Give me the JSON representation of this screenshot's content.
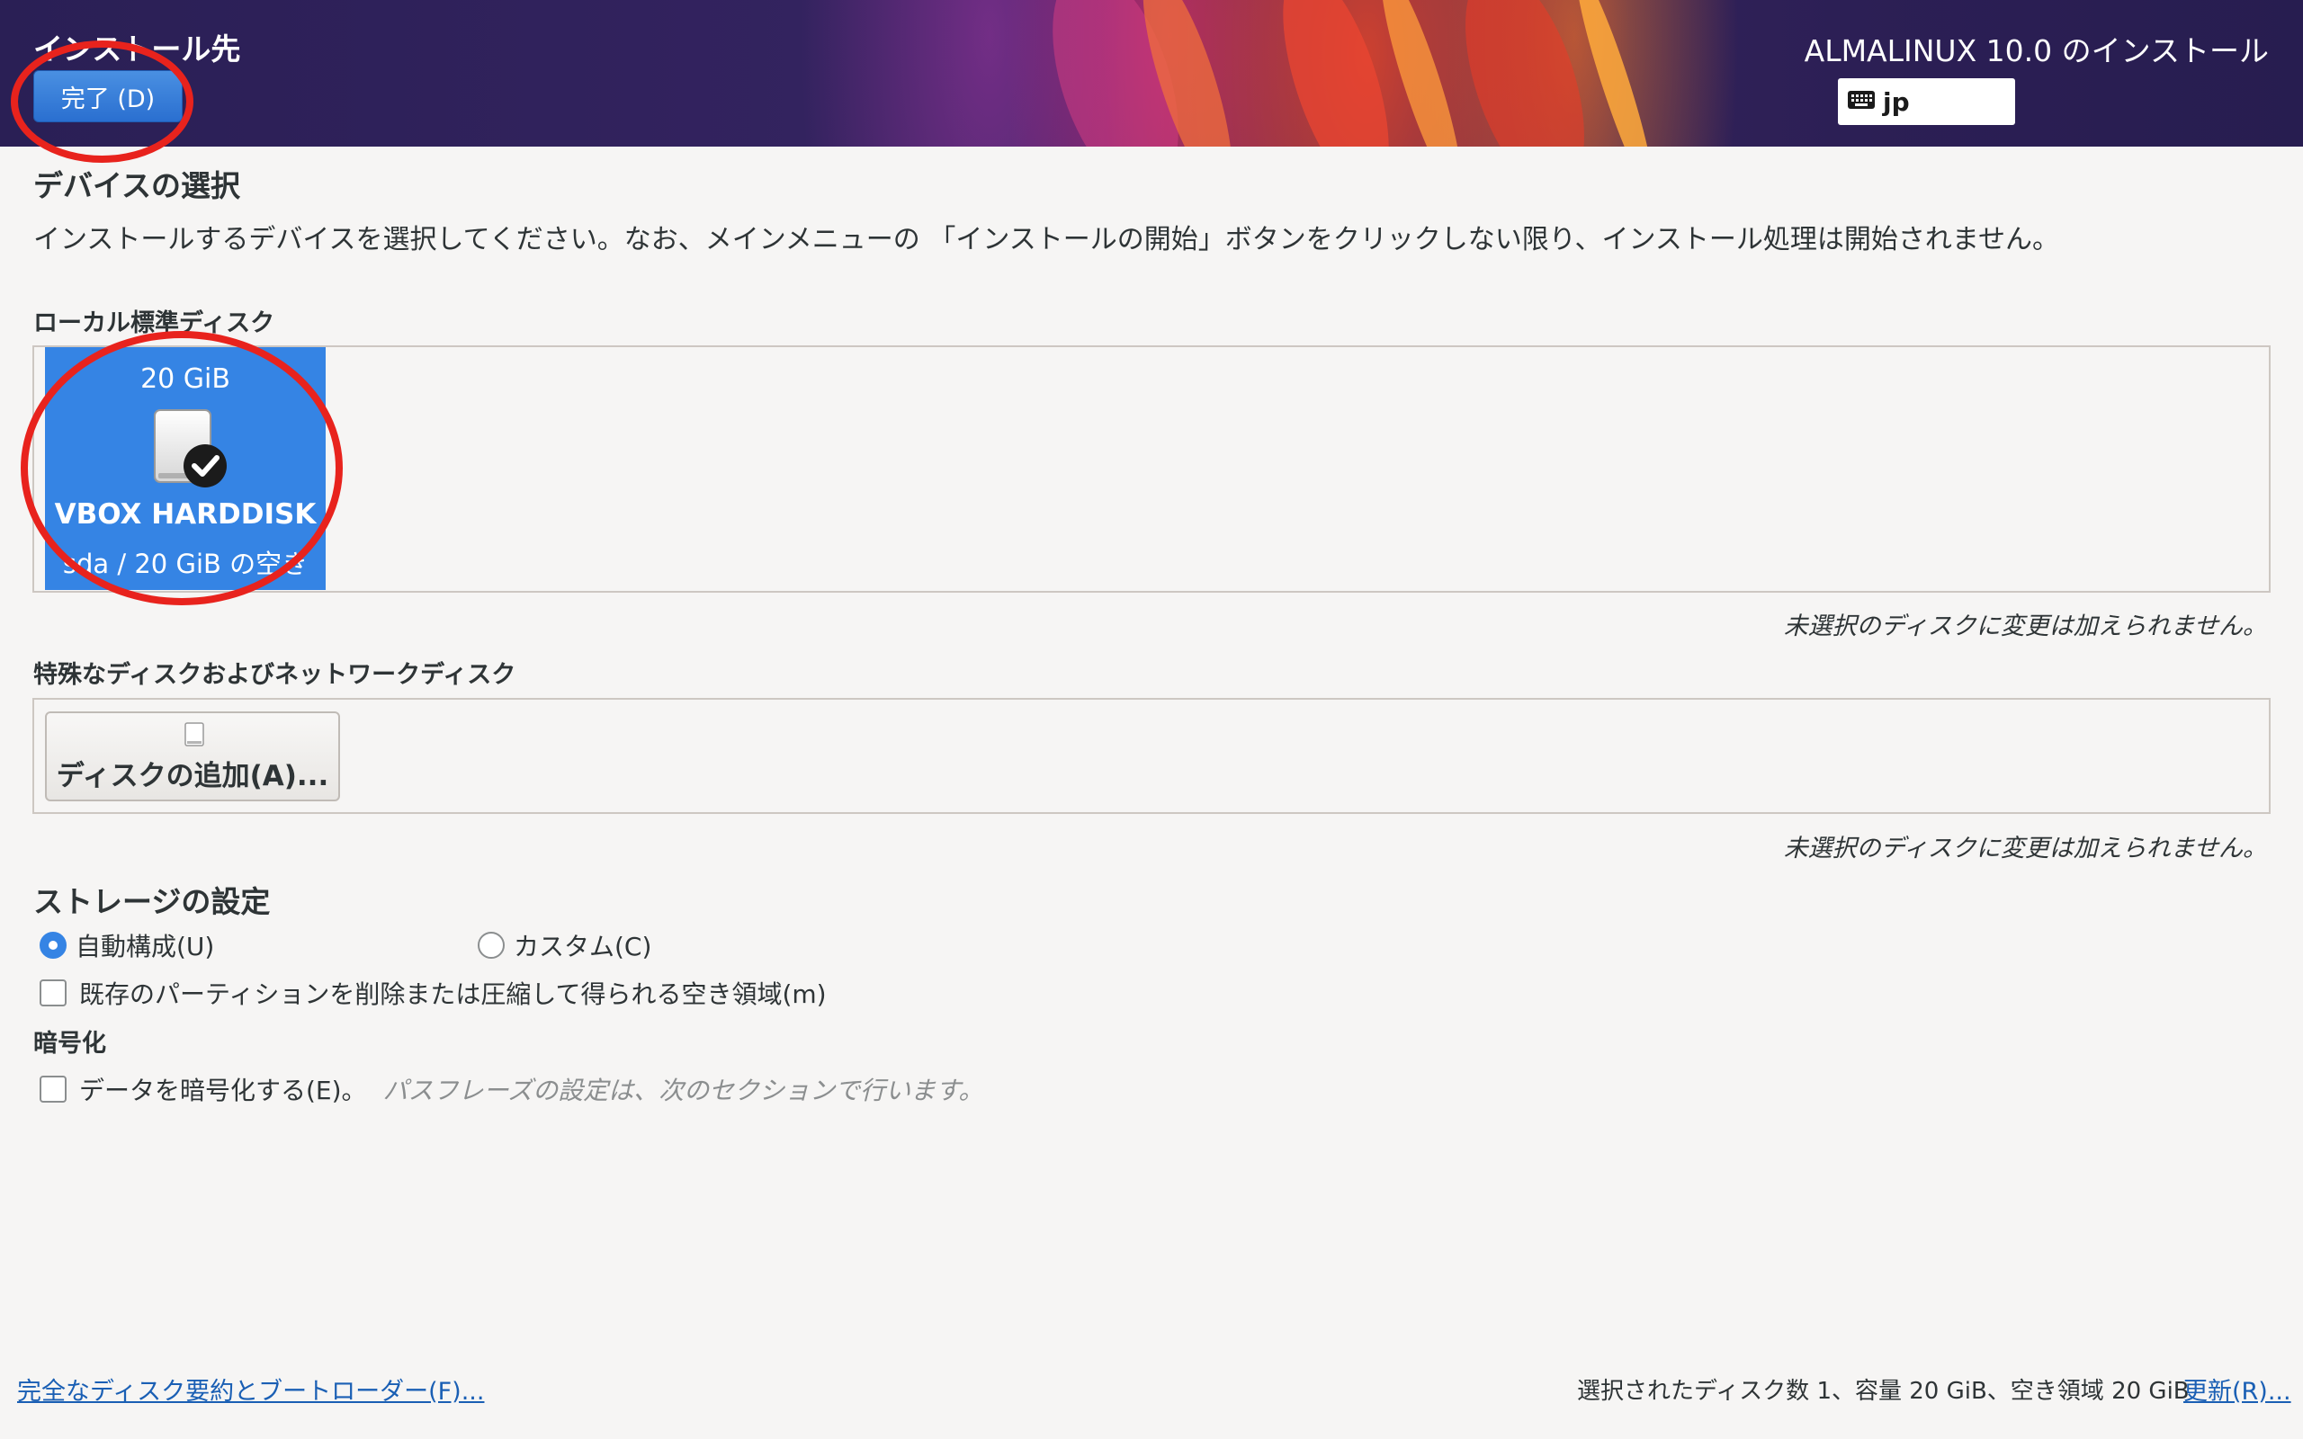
{
  "header": {
    "title": "インストール先",
    "done_label": "完了 (D)",
    "product_title": "ALMALINUX 10.0 のインストール",
    "keyboard_layout": "jp"
  },
  "device_selection": {
    "heading": "デバイスの選択",
    "description": "インストールするデバイスを選択してください。なお、メインメニューの 「インストールの開始」ボタンをクリックしない限り、インストール処理は開始されません。"
  },
  "local_disks": {
    "heading": "ローカル標準ディスク",
    "disks": [
      {
        "size": "20 GiB",
        "name": "VBOX HARDDISK",
        "info": "sda / 20 GiB の空き",
        "selected": true
      }
    ],
    "note": "未選択のディスクに変更は加えられません。"
  },
  "special_disks": {
    "heading": "特殊なディスクおよびネットワークディスク",
    "add_disk_label": "ディスクの追加(A)...",
    "note": "未選択のディスクに変更は加えられません。"
  },
  "storage_config": {
    "heading": "ストレージの設定",
    "auto_label": "自動構成(U)",
    "custom_label": "カスタム(C)",
    "selected": "auto",
    "reclaim_label": "既存のパーティションを削除または圧縮して得られる空き領域(m)"
  },
  "encryption": {
    "heading": "暗号化",
    "encrypt_label": "データを暗号化する(E)。",
    "hint": "パスフレーズの設定は、次のセクションで行います。"
  },
  "footer": {
    "summary_link": "完全なディスク要約とブートローダー(F)...",
    "status": "選択されたディスク数 1、容量 20 GiB、空き領域 20 GiB",
    "refresh_link": "更新(R)..."
  },
  "colors": {
    "accent": "#3584e4",
    "annotation": "#e8231d",
    "link": "#1a5fb4"
  }
}
